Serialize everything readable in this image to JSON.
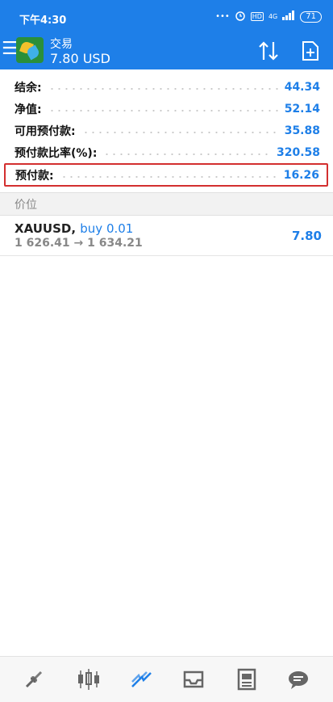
{
  "status_bar": {
    "time": "下午4:30",
    "dots": "•••",
    "network_badge": "HD",
    "network_type": "4G",
    "battery": "71"
  },
  "header": {
    "title": "交易",
    "balance": "7.80 USD"
  },
  "summary": [
    {
      "label": "结余:",
      "value": "44.34"
    },
    {
      "label": "净值:",
      "value": "52.14"
    },
    {
      "label": "可用预付款:",
      "value": "35.88"
    },
    {
      "label": "预付款比率(%):",
      "value": "320.58"
    },
    {
      "label": "预付款:",
      "value": "16.26"
    }
  ],
  "section": {
    "title": "价位"
  },
  "position": {
    "symbol": "XAUUSD,",
    "direction": "buy 0.01",
    "prices": "1 626.41 → 1 634.21",
    "profit": "7.80"
  },
  "bottom_nav": [
    {
      "icon": "quotes-icon",
      "active": false
    },
    {
      "icon": "chart-icon",
      "active": false
    },
    {
      "icon": "trade-icon",
      "active": true
    },
    {
      "icon": "history-icon",
      "active": false
    },
    {
      "icon": "news-icon",
      "active": false
    },
    {
      "icon": "messages-icon",
      "active": false
    }
  ],
  "colors": {
    "accent": "#1e7fe8",
    "highlight_border": "#d32f2f",
    "muted_text": "#888888"
  }
}
